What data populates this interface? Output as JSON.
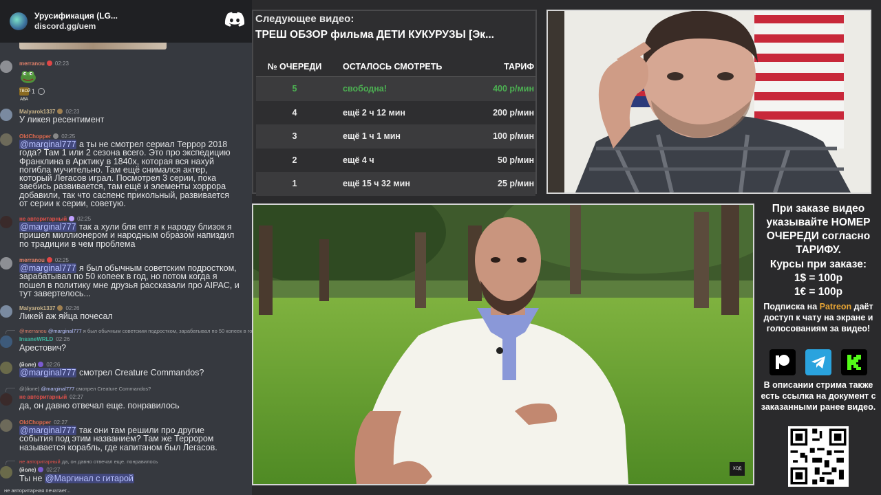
{
  "discord": {
    "server_name": "Урусификация (LG...",
    "invite": "discord.gg/uem",
    "icon": "discord-logo-icon"
  },
  "chat": {
    "messages": [
      {
        "user": "merranou",
        "time": "02:23",
        "color": "#e0806a",
        "kind": "emoji",
        "reaction_count": "1",
        "reaction_label": "ТВОЙ АВА"
      },
      {
        "user": "Malyarok1337",
        "time": "02:23",
        "color": "#c9b48a",
        "text": "У ликея ресентимент"
      },
      {
        "user": "OldChopper",
        "time": "02:25",
        "color": "#e06a50",
        "mention": "@marginal777",
        "lines": [
          " а ты не смотрел сериал Террор 2018",
          "года? Там 1 или 2 сезона всего. Это про экспедицию",
          "Франклина в Арктику в 1840х, которая вся нахуй",
          "погибла мучительно. Там ещё снимался актер,",
          "который Легасов играл. Посмотрел 3 серии, пока",
          "заебись развивается, там ещё и элементы хоррора",
          "добавили, так что саспенс прикольный, развивается",
          "от серии к серии, советую."
        ]
      },
      {
        "user": "не авторитарный",
        "time": "02:25",
        "color": "#e0504a",
        "mention": "@marginal777",
        "lines": [
          " так а хули бля епт я к народу близок я",
          "пришел миллионером и народным образом напиздил",
          "по традиции в чем проблема"
        ]
      },
      {
        "user": "merranou",
        "time": "02:25",
        "color": "#e0806a",
        "mention": "@marginal777",
        "lines": [
          " я был обычным советским подростком,",
          "зарабатывал по 50 копеек в год, но потом когда я",
          "пошел в политику мне друзья рассказали про AIPAC, и",
          "тут завертелось..."
        ]
      },
      {
        "user": "Malyarok1337",
        "time": "02:26",
        "color": "#c9b48a",
        "text": "Ликей аж яйца почесал"
      },
      {
        "reply_user": "@merranou",
        "reply_mention": "@marginal777",
        "reply_text": " я был обычным советским подростком, зарабатывал по 50 копеек в го",
        "user": "InsaneWRLD",
        "time": "02:26",
        "color": "#3fb7a0",
        "text": "Арестович?"
      },
      {
        "user": "(йоле)",
        "time": "02:26",
        "color": "#d8d8d8",
        "mention": "@marginal777",
        "text": " смотрел Creature Commandos?"
      },
      {
        "reply_user": "@(йоле)",
        "reply_mention": "@marginal777",
        "reply_text": " смотрел Creature Commandos?",
        "user": "не авторитарный",
        "time": "02:27",
        "color": "#e0504a",
        "text": "да, он давно отвечал еще. понравилось"
      },
      {
        "user": "OldChopper",
        "time": "02:27",
        "color": "#e06a50",
        "mention": "@marginal777",
        "lines": [
          " так они там решили про другие",
          "события под этим названием? Там же Террором",
          "называется корабль, где капитаном был Легасов."
        ]
      },
      {
        "reply_user": "не авторитарный",
        "reply_text": " да, он давно отвечал еще. понравилось",
        "user": "(йоле)",
        "time": "02:27",
        "color": "#d8d8d8",
        "prefix": "Ты не ",
        "mention": "@Маргинал с гитарой"
      }
    ],
    "typing": "не авторитарная печатает..."
  },
  "queue": {
    "next_label": "Следующее видео:",
    "next_title": "ТРЕШ ОБЗОР фильма ДЕТИ КУКУРУЗЫ [Эк...",
    "headers": [
      "№ ОЧЕРЕДИ",
      "ОСТАЛОСЬ СМОТРЕТЬ",
      "ТАРИФ"
    ],
    "rows": [
      {
        "num": "5",
        "remaining": "свободна!",
        "price": "400 р/мин",
        "free": true
      },
      {
        "num": "4",
        "remaining": "ещё 2 ч 12 мин",
        "price": "200 р/мин"
      },
      {
        "num": "3",
        "remaining": "ещё 1 ч 1 мин",
        "price": "100 р/мин"
      },
      {
        "num": "2",
        "remaining": "ещё 4 ч",
        "price": "50 р/мин"
      },
      {
        "num": "1",
        "remaining": "ещё 15 ч 32 мин",
        "price": "25 р/мин"
      }
    ]
  },
  "info": {
    "order_text": "При заказе видео указывайте НОМЕР ОЧЕРЕДИ согласно ТАРИФУ.",
    "rates_title": "Курсы при заказе:",
    "rate_usd": "1$ = 100р",
    "rate_eur": "1€ = 100р",
    "sub_prefix": "Подписка на ",
    "sub_brand": "Patreon",
    "sub_suffix": " даёт доступ к чату на экране и голосованиям за видео!",
    "desc_text": "В описании стрима также есть ссылка на документ с заказанными ранее видео.",
    "social_icons": [
      "patreon-icon",
      "telegram-icon",
      "kick-icon"
    ]
  },
  "video": {
    "watermark": "ХОД"
  },
  "colors": {
    "free": "#4cb052",
    "patreon": "#e8a534",
    "mention": "#b9c2ff",
    "telegram": "#2aa3de",
    "kick": "#53fc18"
  }
}
